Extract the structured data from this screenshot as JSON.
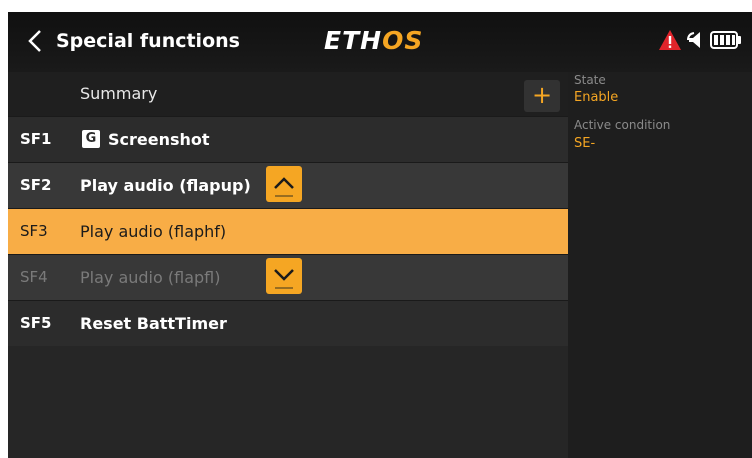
{
  "header": {
    "title": "Special functions",
    "logo_main": "ETH",
    "logo_accent": "OS",
    "back_icon": "chevron-left-icon",
    "status_icons": [
      "warning-icon",
      "speaker-icon",
      "battery-icon"
    ]
  },
  "list": {
    "summary_label": "Summary",
    "add_label": "+",
    "rows": [
      {
        "id": "SF1",
        "name": "Screenshot",
        "icon": "g-icon",
        "state": "normal"
      },
      {
        "id": "SF2",
        "name": "Play audio (flapup)",
        "state": "normal"
      },
      {
        "id": "SF3",
        "name": "Play audio (flaphf)",
        "state": "selected"
      },
      {
        "id": "SF4",
        "name": "Play audio (flapfl)",
        "state": "disabled"
      },
      {
        "id": "SF5",
        "name": "Reset BattTimer",
        "state": "normal"
      }
    ],
    "icon_letter": "G",
    "move_up_icon": "chevron-up-icon",
    "move_down_icon": "chevron-down-icon"
  },
  "properties": {
    "state_label": "State",
    "state_value": "Enable",
    "condition_label": "Active condition",
    "condition_value": "SE-"
  },
  "colors": {
    "accent": "#f5a623",
    "selected_row": "#f8ad46",
    "warning": "#e0242b"
  }
}
